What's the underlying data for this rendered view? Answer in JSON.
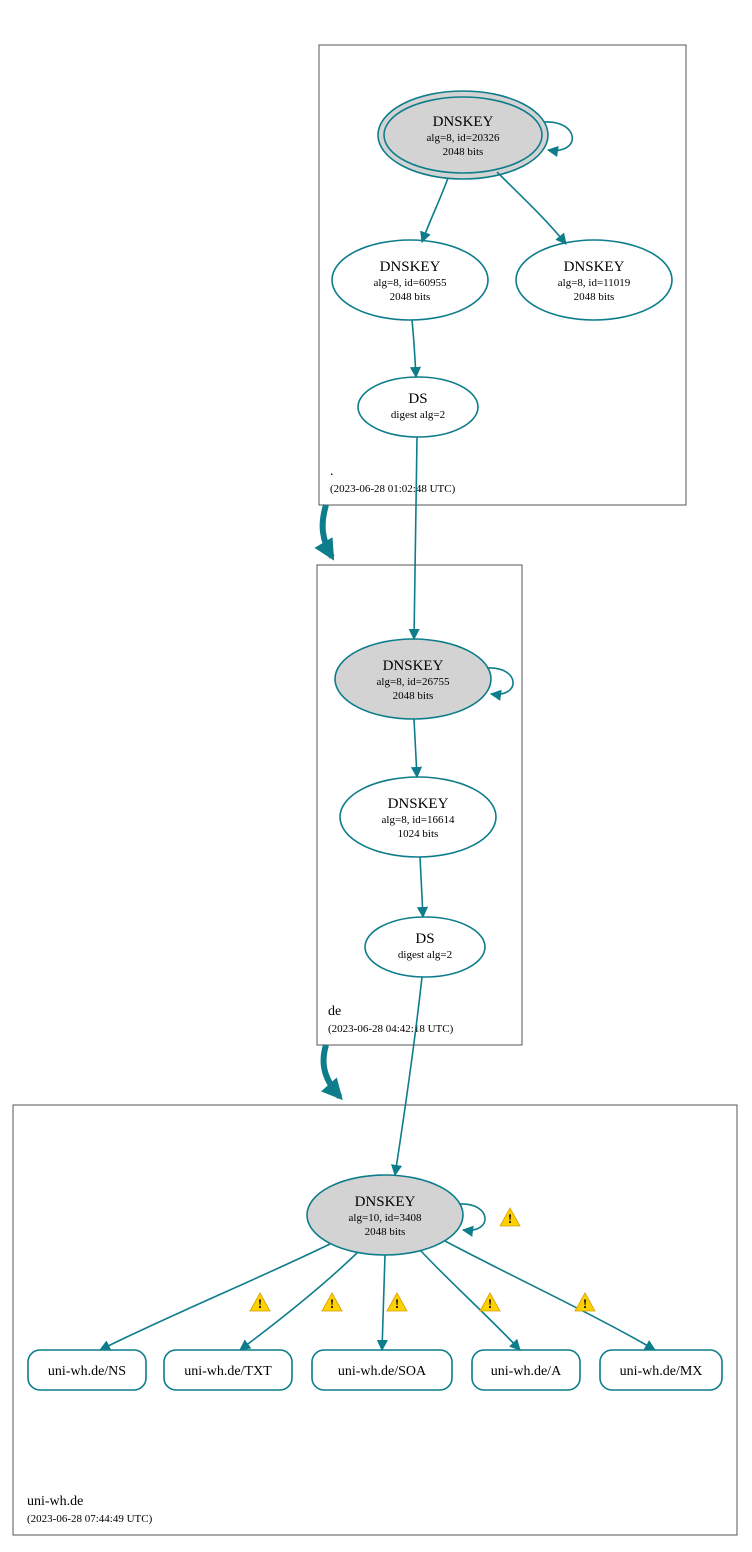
{
  "zones": {
    "root": {
      "label": ".",
      "timestamp": "(2023-06-28 01:02:48 UTC)",
      "dnskey_root": {
        "title": "DNSKEY",
        "sub1": "alg=8, id=20326",
        "sub2": "2048 bits"
      },
      "dnskey_left": {
        "title": "DNSKEY",
        "sub1": "alg=8, id=60955",
        "sub2": "2048 bits"
      },
      "dnskey_right": {
        "title": "DNSKEY",
        "sub1": "alg=8, id=11019",
        "sub2": "2048 bits"
      },
      "ds": {
        "title": "DS",
        "sub1": "digest alg=2"
      }
    },
    "de": {
      "label": "de",
      "timestamp": "(2023-06-28 04:42:18 UTC)",
      "dnskey_top": {
        "title": "DNSKEY",
        "sub1": "alg=8, id=26755",
        "sub2": "2048 bits"
      },
      "dnskey_mid": {
        "title": "DNSKEY",
        "sub1": "alg=8, id=16614",
        "sub2": "1024 bits"
      },
      "ds": {
        "title": "DS",
        "sub1": "digest alg=2"
      }
    },
    "uniwh": {
      "label": "uni-wh.de",
      "timestamp": "(2023-06-28 07:44:49 UTC)",
      "dnskey": {
        "title": "DNSKEY",
        "sub1": "alg=10, id=3408",
        "sub2": "2048 bits"
      },
      "records": {
        "ns": "uni-wh.de/NS",
        "txt": "uni-wh.de/TXT",
        "soa": "uni-wh.de/SOA",
        "a": "uni-wh.de/A",
        "mx": "uni-wh.de/MX"
      }
    }
  }
}
